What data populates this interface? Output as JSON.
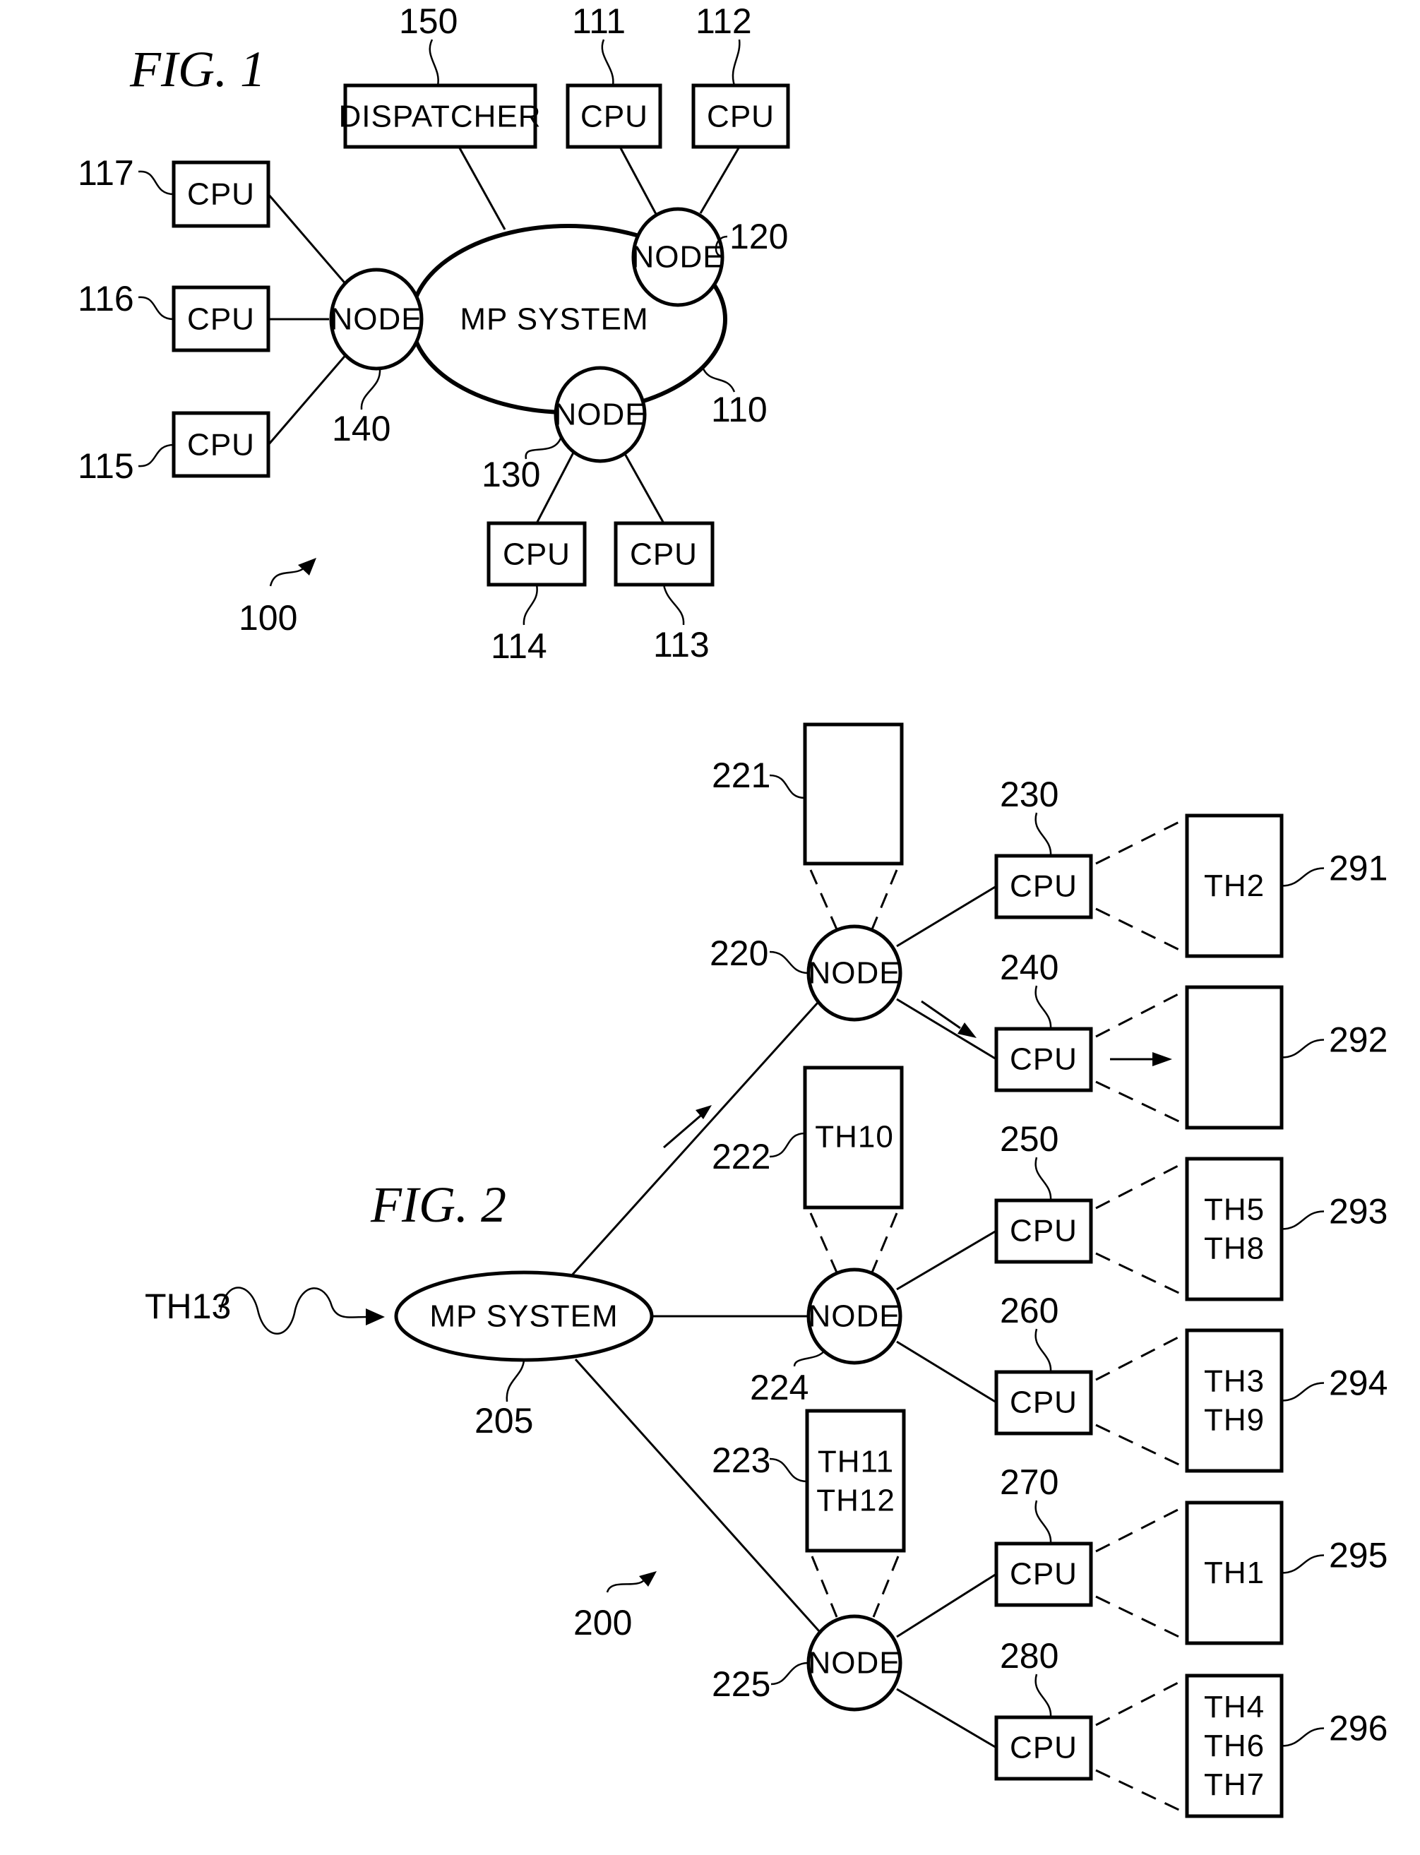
{
  "fig1": {
    "title": "FIG.  1",
    "ref": "100",
    "system": {
      "label": "MP SYSTEM",
      "ref": "110"
    },
    "dispatcher": {
      "label": "DISPATCHER",
      "ref": "150"
    },
    "nodes": [
      {
        "label": "NODE",
        "ref": "120"
      },
      {
        "label": "NODE",
        "ref": "130"
      },
      {
        "label": "NODE",
        "ref": "140"
      }
    ],
    "cpus": [
      {
        "label": "CPU",
        "ref": "111"
      },
      {
        "label": "CPU",
        "ref": "112"
      },
      {
        "label": "CPU",
        "ref": "113"
      },
      {
        "label": "CPU",
        "ref": "114"
      },
      {
        "label": "CPU",
        "ref": "115"
      },
      {
        "label": "CPU",
        "ref": "116"
      },
      {
        "label": "CPU",
        "ref": "117"
      }
    ]
  },
  "fig2": {
    "title": "FIG.  2",
    "ref": "200",
    "incoming_thread": "TH13",
    "system": {
      "label": "MP SYSTEM",
      "ref": "205"
    },
    "nodes": [
      {
        "label": "NODE",
        "ref": "220",
        "queue_ref": "221",
        "queue": []
      },
      {
        "label": "NODE",
        "ref": "224",
        "queue_ref": "222",
        "queue": [
          "TH10"
        ]
      },
      {
        "label": "NODE",
        "ref": "225",
        "queue_ref": "223",
        "queue": [
          "TH11",
          "TH12"
        ]
      }
    ],
    "cpus": [
      {
        "label": "CPU",
        "ref": "230",
        "queue_ref": "291",
        "queue": [
          "TH2"
        ]
      },
      {
        "label": "CPU",
        "ref": "240",
        "queue_ref": "292",
        "queue": []
      },
      {
        "label": "CPU",
        "ref": "250",
        "queue_ref": "293",
        "queue": [
          "TH5",
          "TH8"
        ]
      },
      {
        "label": "CPU",
        "ref": "260",
        "queue_ref": "294",
        "queue": [
          "TH3",
          "TH9"
        ]
      },
      {
        "label": "CPU",
        "ref": "270",
        "queue_ref": "295",
        "queue": [
          "TH1"
        ]
      },
      {
        "label": "CPU",
        "ref": "280",
        "queue_ref": "296",
        "queue": [
          "TH4",
          "TH6",
          "TH7"
        ]
      }
    ]
  }
}
